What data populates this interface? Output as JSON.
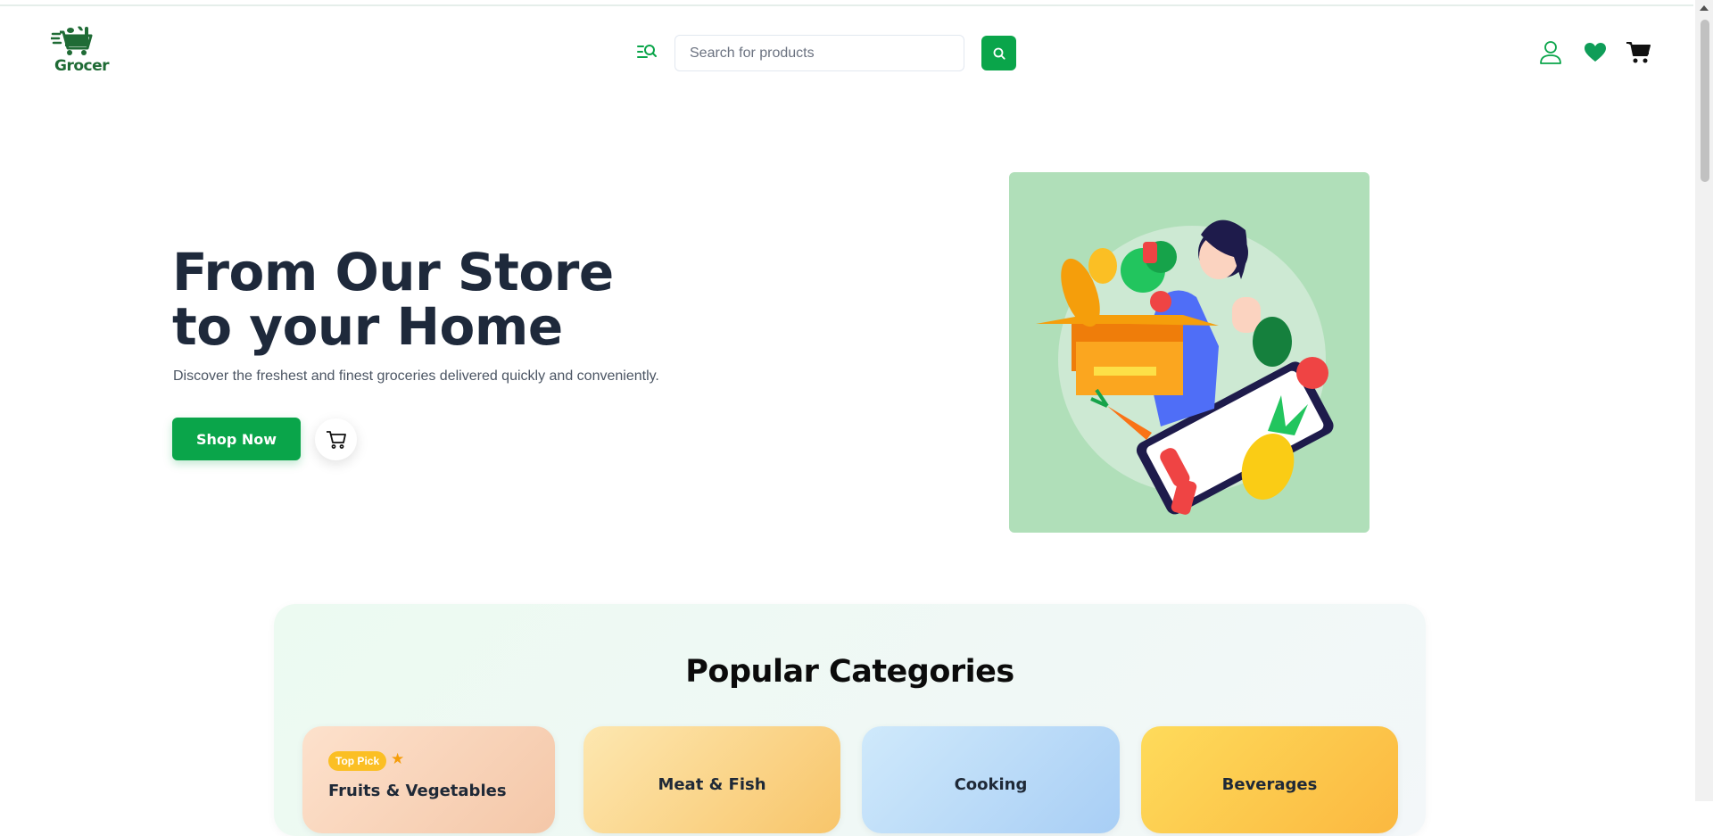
{
  "header": {
    "logo_text": "Grocer",
    "search_placeholder": "Search for products",
    "icons": [
      "filter-search-icon",
      "search-icon",
      "user-icon",
      "heart-icon",
      "cart-icon"
    ]
  },
  "hero": {
    "title_line1": "From Our Store",
    "title_line2": "to your Home",
    "subtitle": "Discover the freshest and finest groceries delivered quickly and conveniently.",
    "cta_label": "Shop Now"
  },
  "categories": {
    "title": "Popular Categories",
    "items": [
      {
        "label": "Fruits & Vegetables",
        "badge": "Top Pick"
      },
      {
        "label": "Meat & Fish"
      },
      {
        "label": "Cooking"
      },
      {
        "label": "Beverages"
      }
    ]
  },
  "colors": {
    "brand_green": "#0aa54a",
    "logo_green": "#1f6b35",
    "hero_bg": "#b0dfb9",
    "title_dark": "#1e293b"
  }
}
